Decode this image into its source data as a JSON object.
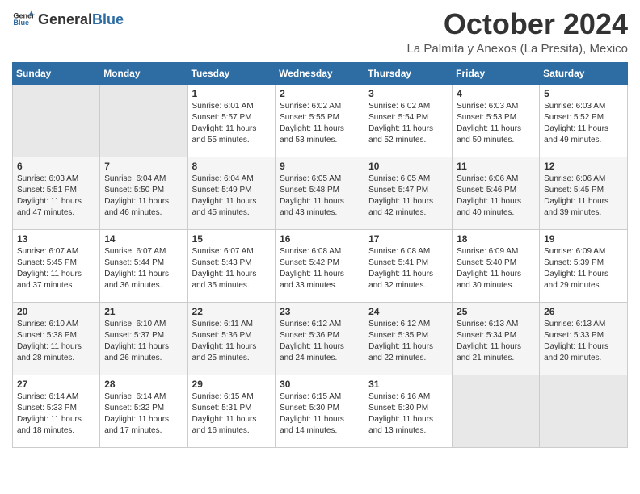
{
  "header": {
    "logo_general": "General",
    "logo_blue": "Blue",
    "title": "October 2024",
    "subtitle": "La Palmita y Anexos (La Presita), Mexico"
  },
  "calendar": {
    "days_of_week": [
      "Sunday",
      "Monday",
      "Tuesday",
      "Wednesday",
      "Thursday",
      "Friday",
      "Saturday"
    ],
    "weeks": [
      [
        {
          "day": "",
          "empty": true
        },
        {
          "day": "",
          "empty": true
        },
        {
          "day": "1",
          "sunrise": "6:01 AM",
          "sunset": "5:57 PM",
          "daylight": "11 hours and 55 minutes."
        },
        {
          "day": "2",
          "sunrise": "6:02 AM",
          "sunset": "5:55 PM",
          "daylight": "11 hours and 53 minutes."
        },
        {
          "day": "3",
          "sunrise": "6:02 AM",
          "sunset": "5:54 PM",
          "daylight": "11 hours and 52 minutes."
        },
        {
          "day": "4",
          "sunrise": "6:03 AM",
          "sunset": "5:53 PM",
          "daylight": "11 hours and 50 minutes."
        },
        {
          "day": "5",
          "sunrise": "6:03 AM",
          "sunset": "5:52 PM",
          "daylight": "11 hours and 49 minutes."
        }
      ],
      [
        {
          "day": "6",
          "sunrise": "6:03 AM",
          "sunset": "5:51 PM",
          "daylight": "11 hours and 47 minutes."
        },
        {
          "day": "7",
          "sunrise": "6:04 AM",
          "sunset": "5:50 PM",
          "daylight": "11 hours and 46 minutes."
        },
        {
          "day": "8",
          "sunrise": "6:04 AM",
          "sunset": "5:49 PM",
          "daylight": "11 hours and 45 minutes."
        },
        {
          "day": "9",
          "sunrise": "6:05 AM",
          "sunset": "5:48 PM",
          "daylight": "11 hours and 43 minutes."
        },
        {
          "day": "10",
          "sunrise": "6:05 AM",
          "sunset": "5:47 PM",
          "daylight": "11 hours and 42 minutes."
        },
        {
          "day": "11",
          "sunrise": "6:06 AM",
          "sunset": "5:46 PM",
          "daylight": "11 hours and 40 minutes."
        },
        {
          "day": "12",
          "sunrise": "6:06 AM",
          "sunset": "5:45 PM",
          "daylight": "11 hours and 39 minutes."
        }
      ],
      [
        {
          "day": "13",
          "sunrise": "6:07 AM",
          "sunset": "5:45 PM",
          "daylight": "11 hours and 37 minutes."
        },
        {
          "day": "14",
          "sunrise": "6:07 AM",
          "sunset": "5:44 PM",
          "daylight": "11 hours and 36 minutes."
        },
        {
          "day": "15",
          "sunrise": "6:07 AM",
          "sunset": "5:43 PM",
          "daylight": "11 hours and 35 minutes."
        },
        {
          "day": "16",
          "sunrise": "6:08 AM",
          "sunset": "5:42 PM",
          "daylight": "11 hours and 33 minutes."
        },
        {
          "day": "17",
          "sunrise": "6:08 AM",
          "sunset": "5:41 PM",
          "daylight": "11 hours and 32 minutes."
        },
        {
          "day": "18",
          "sunrise": "6:09 AM",
          "sunset": "5:40 PM",
          "daylight": "11 hours and 30 minutes."
        },
        {
          "day": "19",
          "sunrise": "6:09 AM",
          "sunset": "5:39 PM",
          "daylight": "11 hours and 29 minutes."
        }
      ],
      [
        {
          "day": "20",
          "sunrise": "6:10 AM",
          "sunset": "5:38 PM",
          "daylight": "11 hours and 28 minutes."
        },
        {
          "day": "21",
          "sunrise": "6:10 AM",
          "sunset": "5:37 PM",
          "daylight": "11 hours and 26 minutes."
        },
        {
          "day": "22",
          "sunrise": "6:11 AM",
          "sunset": "5:36 PM",
          "daylight": "11 hours and 25 minutes."
        },
        {
          "day": "23",
          "sunrise": "6:12 AM",
          "sunset": "5:36 PM",
          "daylight": "11 hours and 24 minutes."
        },
        {
          "day": "24",
          "sunrise": "6:12 AM",
          "sunset": "5:35 PM",
          "daylight": "11 hours and 22 minutes."
        },
        {
          "day": "25",
          "sunrise": "6:13 AM",
          "sunset": "5:34 PM",
          "daylight": "11 hours and 21 minutes."
        },
        {
          "day": "26",
          "sunrise": "6:13 AM",
          "sunset": "5:33 PM",
          "daylight": "11 hours and 20 minutes."
        }
      ],
      [
        {
          "day": "27",
          "sunrise": "6:14 AM",
          "sunset": "5:33 PM",
          "daylight": "11 hours and 18 minutes."
        },
        {
          "day": "28",
          "sunrise": "6:14 AM",
          "sunset": "5:32 PM",
          "daylight": "11 hours and 17 minutes."
        },
        {
          "day": "29",
          "sunrise": "6:15 AM",
          "sunset": "5:31 PM",
          "daylight": "11 hours and 16 minutes."
        },
        {
          "day": "30",
          "sunrise": "6:15 AM",
          "sunset": "5:30 PM",
          "daylight": "11 hours and 14 minutes."
        },
        {
          "day": "31",
          "sunrise": "6:16 AM",
          "sunset": "5:30 PM",
          "daylight": "11 hours and 13 minutes."
        },
        {
          "day": "",
          "empty": true
        },
        {
          "day": "",
          "empty": true
        }
      ]
    ],
    "sunrise_label": "Sunrise:",
    "sunset_label": "Sunset:",
    "daylight_label": "Daylight:"
  }
}
